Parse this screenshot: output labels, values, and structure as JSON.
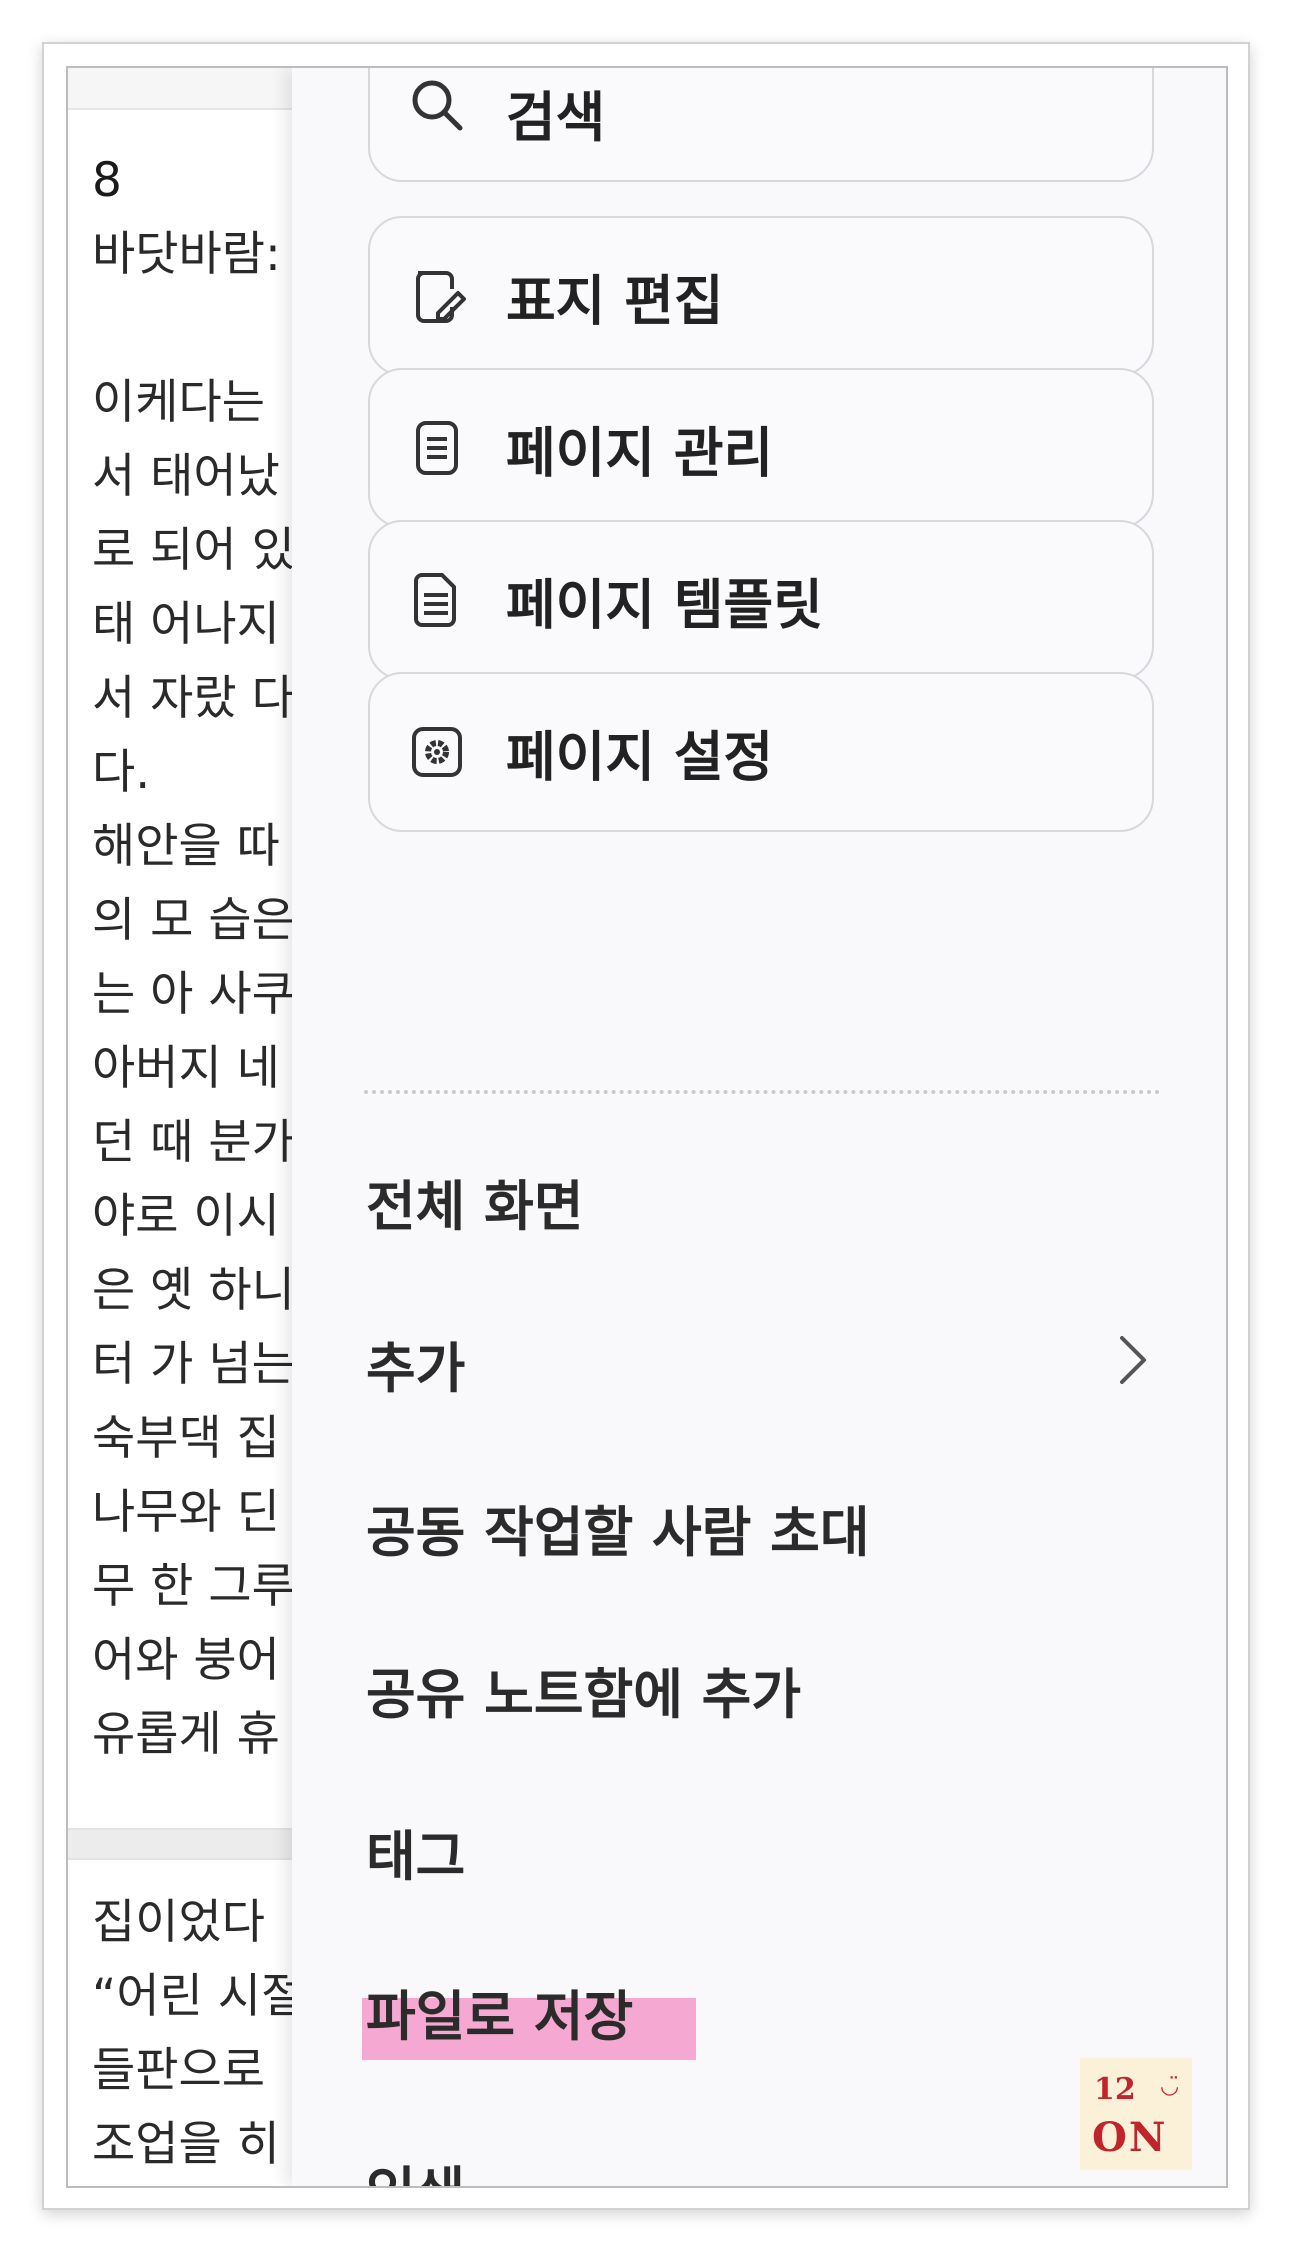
{
  "note": {
    "page1": {
      "number": "8",
      "lines_a": [
        "바닷바람:"
      ],
      "lines_b": [
        "이케다는",
        "서 태어났",
        "로 되어 있",
        "태 어나지",
        "서 자랐 다",
        "다.",
        "해안을 따",
        "의 모 습은",
        "는 아 사쿠",
        "아버지 네",
        "던 때 분가",
        "야로 이시",
        "은 옛 하니",
        "터 가 넘는",
        "숙부댁 집",
        "나무와 딘",
        "무 한 그루",
        "어와 붕어",
        "유롭게 휴"
      ]
    },
    "page2": {
      "lines": [
        "집이었다",
        "“어린 시절",
        "들판으로",
        "조업을 히"
      ]
    }
  },
  "menu": {
    "cards": [
      {
        "label": "검색",
        "icon": "search-icon"
      },
      {
        "label": "표지 편집",
        "icon": "cover-edit-icon"
      },
      {
        "label": "페이지 관리",
        "icon": "page-manage-icon"
      },
      {
        "label": "페이지 템플릿",
        "icon": "page-template-icon"
      },
      {
        "label": "페이지 설정",
        "icon": "page-settings-icon"
      }
    ],
    "items": [
      {
        "label": "전체 화면"
      },
      {
        "label": "추가"
      },
      {
        "label": "공동 작업할 사람 초대"
      },
      {
        "label": "공유 노트함에 추가"
      },
      {
        "label": "태그"
      },
      {
        "label": "파일로 저장"
      },
      {
        "label": "인쇄"
      }
    ],
    "highlight_color": "#f59ac9"
  },
  "logo": {
    "line1": "12",
    "smile": "◡̈",
    "line2": "ON",
    "color": "#c0252b"
  }
}
